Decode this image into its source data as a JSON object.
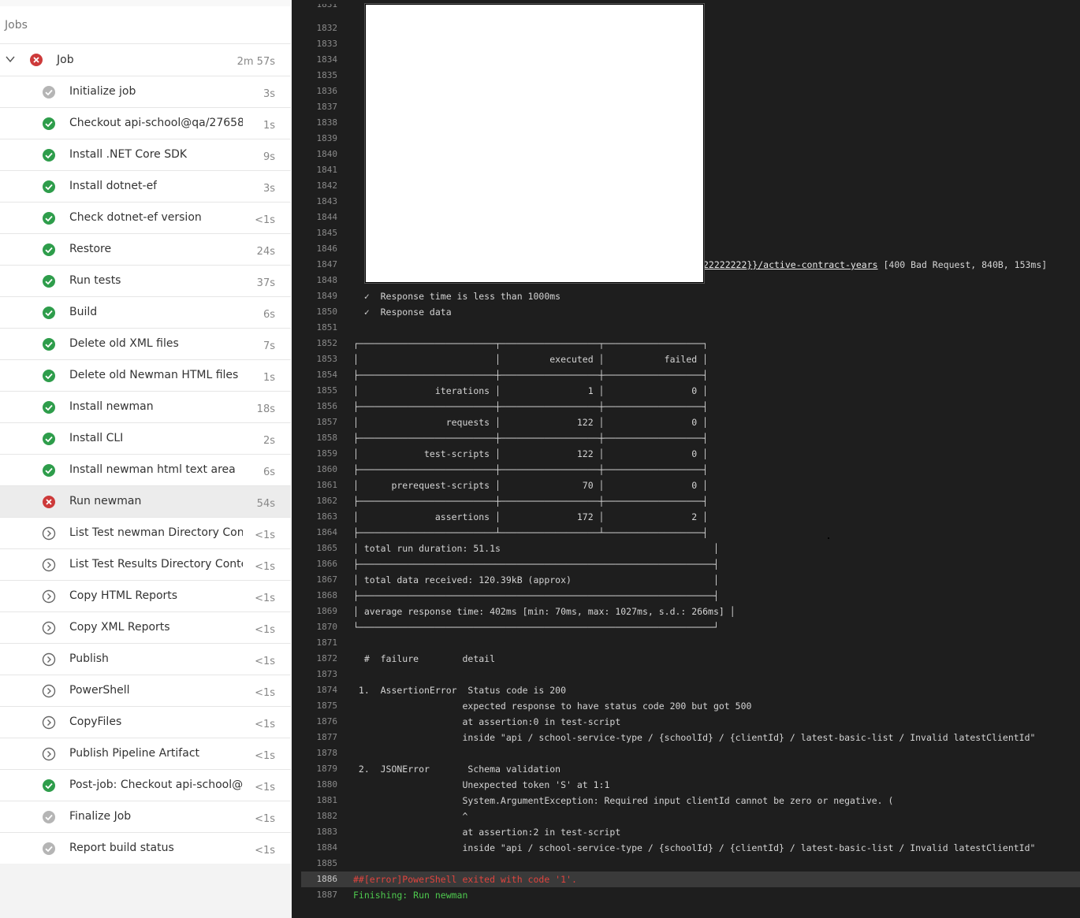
{
  "sidebar": {
    "header": "Jobs",
    "job": {
      "label": "Job",
      "duration": "2m 57s",
      "status": "failed"
    },
    "steps": [
      {
        "label": "Initialize job",
        "duration": "3s",
        "status": "done-gray"
      },
      {
        "label": "Checkout api-school@qa/27658-...",
        "duration": "1s",
        "status": "success"
      },
      {
        "label": "Install .NET Core SDK",
        "duration": "9s",
        "status": "success"
      },
      {
        "label": "Install dotnet-ef",
        "duration": "3s",
        "status": "success"
      },
      {
        "label": "Check dotnet-ef version",
        "duration": "<1s",
        "status": "success"
      },
      {
        "label": "Restore",
        "duration": "24s",
        "status": "success"
      },
      {
        "label": "Run tests",
        "duration": "37s",
        "status": "success"
      },
      {
        "label": "Build",
        "duration": "6s",
        "status": "success"
      },
      {
        "label": "Delete old XML files",
        "duration": "7s",
        "status": "success"
      },
      {
        "label": "Delete old Newman HTML files",
        "duration": "1s",
        "status": "success"
      },
      {
        "label": "Install newman",
        "duration": "18s",
        "status": "success"
      },
      {
        "label": "Install CLI",
        "duration": "2s",
        "status": "success"
      },
      {
        "label": "Install newman html text area",
        "duration": "6s",
        "status": "success"
      },
      {
        "label": "Run newman",
        "duration": "54s",
        "status": "failed"
      },
      {
        "label": "List Test newman Directory Cont...",
        "duration": "<1s",
        "status": "skipped"
      },
      {
        "label": "List Test Results Directory Conte...",
        "duration": "<1s",
        "status": "skipped"
      },
      {
        "label": "Copy HTML Reports",
        "duration": "<1s",
        "status": "skipped"
      },
      {
        "label": "Copy XML Reports",
        "duration": "<1s",
        "status": "skipped"
      },
      {
        "label": "Publish",
        "duration": "<1s",
        "status": "skipped"
      },
      {
        "label": "PowerShell",
        "duration": "<1s",
        "status": "skipped"
      },
      {
        "label": "CopyFiles",
        "duration": "<1s",
        "status": "skipped"
      },
      {
        "label": "Publish Pipeline Artifact",
        "duration": "<1s",
        "status": "skipped"
      },
      {
        "label": "Post-job: Checkout api-school@...",
        "duration": "<1s",
        "status": "success"
      },
      {
        "label": "Finalize Job",
        "duration": "<1s",
        "status": "done-gray"
      },
      {
        "label": "Report build status",
        "duration": "<1s",
        "status": "done-gray"
      }
    ]
  },
  "log": {
    "lines": [
      {
        "n": "1832",
        "t": ""
      },
      {
        "n": "1833",
        "t": ""
      },
      {
        "n": "1834",
        "t": ""
      },
      {
        "n": "1835",
        "t": ""
      },
      {
        "n": "1836",
        "t": ""
      },
      {
        "n": "1837",
        "t": ""
      },
      {
        "n": "1838",
        "t": ""
      },
      {
        "n": "1839",
        "t": ""
      },
      {
        "n": "1840",
        "t": ""
      },
      {
        "n": "1841",
        "t": ""
      },
      {
        "n": "1842",
        "t": ""
      },
      {
        "n": "1843",
        "t": ""
      },
      {
        "n": "1844",
        "t": ""
      },
      {
        "n": "1845",
        "t": ""
      },
      {
        "n": "1846",
        "t": ""
      },
      {
        "n": "1847",
        "t": "",
        "link": "22222222}}/active-contract-years",
        "after": " [400 Bad Request, 840B, 153ms]"
      },
      {
        "n": "1848",
        "t": ""
      },
      {
        "n": "1849",
        "t": "  ✓  Response time is less than 1000ms"
      },
      {
        "n": "1850",
        "t": "  ✓  Response data"
      },
      {
        "n": "1851",
        "t": ""
      },
      {
        "n": "1852",
        "t": "┌─────────────────────────┬──────────────────┬──────────────────┐"
      },
      {
        "n": "1853",
        "t": "│                         │         executed │           failed │"
      },
      {
        "n": "1854",
        "t": "├─────────────────────────┼──────────────────┼──────────────────┤"
      },
      {
        "n": "1855",
        "t": "│              iterations │                1 │                0 │"
      },
      {
        "n": "1856",
        "t": "├─────────────────────────┼──────────────────┼──────────────────┤"
      },
      {
        "n": "1857",
        "t": "│                requests │              122 │                0 │"
      },
      {
        "n": "1858",
        "t": "├─────────────────────────┼──────────────────┼──────────────────┤"
      },
      {
        "n": "1859",
        "t": "│            test-scripts │              122 │                0 │"
      },
      {
        "n": "1860",
        "t": "├─────────────────────────┼──────────────────┼──────────────────┤"
      },
      {
        "n": "1861",
        "t": "│      prerequest-scripts │               70 │                0 │"
      },
      {
        "n": "1862",
        "t": "├─────────────────────────┼──────────────────┼──────────────────┤"
      },
      {
        "n": "1863",
        "t": "│              assertions │              172 │                2 │"
      },
      {
        "n": "1864",
        "t": "├─────────────────────────┴──────────────────┴──────────────────┤"
      },
      {
        "n": "1865",
        "t": "│ total run duration: 51.1s                                       │"
      },
      {
        "n": "1866",
        "t": "├─────────────────────────────────────────────────────────────────┤"
      },
      {
        "n": "1867",
        "t": "│ total data received: 120.39kB (approx)                          │"
      },
      {
        "n": "1868",
        "t": "├─────────────────────────────────────────────────────────────────┤"
      },
      {
        "n": "1869",
        "t": "│ average response time: 402ms [min: 70ms, max: 1027ms, s.d.: 266ms] │"
      },
      {
        "n": "1870",
        "t": "└─────────────────────────────────────────────────────────────────┘"
      },
      {
        "n": "1871",
        "t": ""
      },
      {
        "n": "1872",
        "t": "  #  failure        detail"
      },
      {
        "n": "1873",
        "t": ""
      },
      {
        "n": "1874",
        "t": " 1.  AssertionError  Status code is 200"
      },
      {
        "n": "1875",
        "t": "                    expected response to have status code 200 but got 500"
      },
      {
        "n": "1876",
        "t": "                    at assertion:0 in test-script"
      },
      {
        "n": "1877",
        "t": "                    inside \"api / school-service-type / {schoolId} / {clientId} / latest-basic-list / Invalid latestClientId\""
      },
      {
        "n": "1878",
        "t": ""
      },
      {
        "n": "1879",
        "t": " 2.  JSONError       Schema validation"
      },
      {
        "n": "1880",
        "t": "                    Unexpected token 'S' at 1:1"
      },
      {
        "n": "1881",
        "t": "                    System.ArgumentException: Required input clientId cannot be zero or negative. ("
      },
      {
        "n": "1882",
        "t": "                    ^"
      },
      {
        "n": "1883",
        "t": "                    at assertion:2 in test-script"
      },
      {
        "n": "1884",
        "t": "                    inside \"api / school-service-type / {schoolId} / {clientId} / latest-basic-list / Invalid latestClientId\""
      },
      {
        "n": "1885",
        "t": ""
      },
      {
        "n": "1886",
        "t": "##[error]PowerShell exited with code '1'.",
        "kind": "error"
      },
      {
        "n": "1887",
        "t": "Finishing: Run newman",
        "kind": "finish"
      }
    ]
  },
  "colors": {
    "success": "#2e9d4b",
    "failed": "#cd3a3a",
    "gray": "#b5b5b5",
    "skipped": "#666666",
    "error_text": "#e0443e",
    "finish_text": "#4ec94e"
  }
}
